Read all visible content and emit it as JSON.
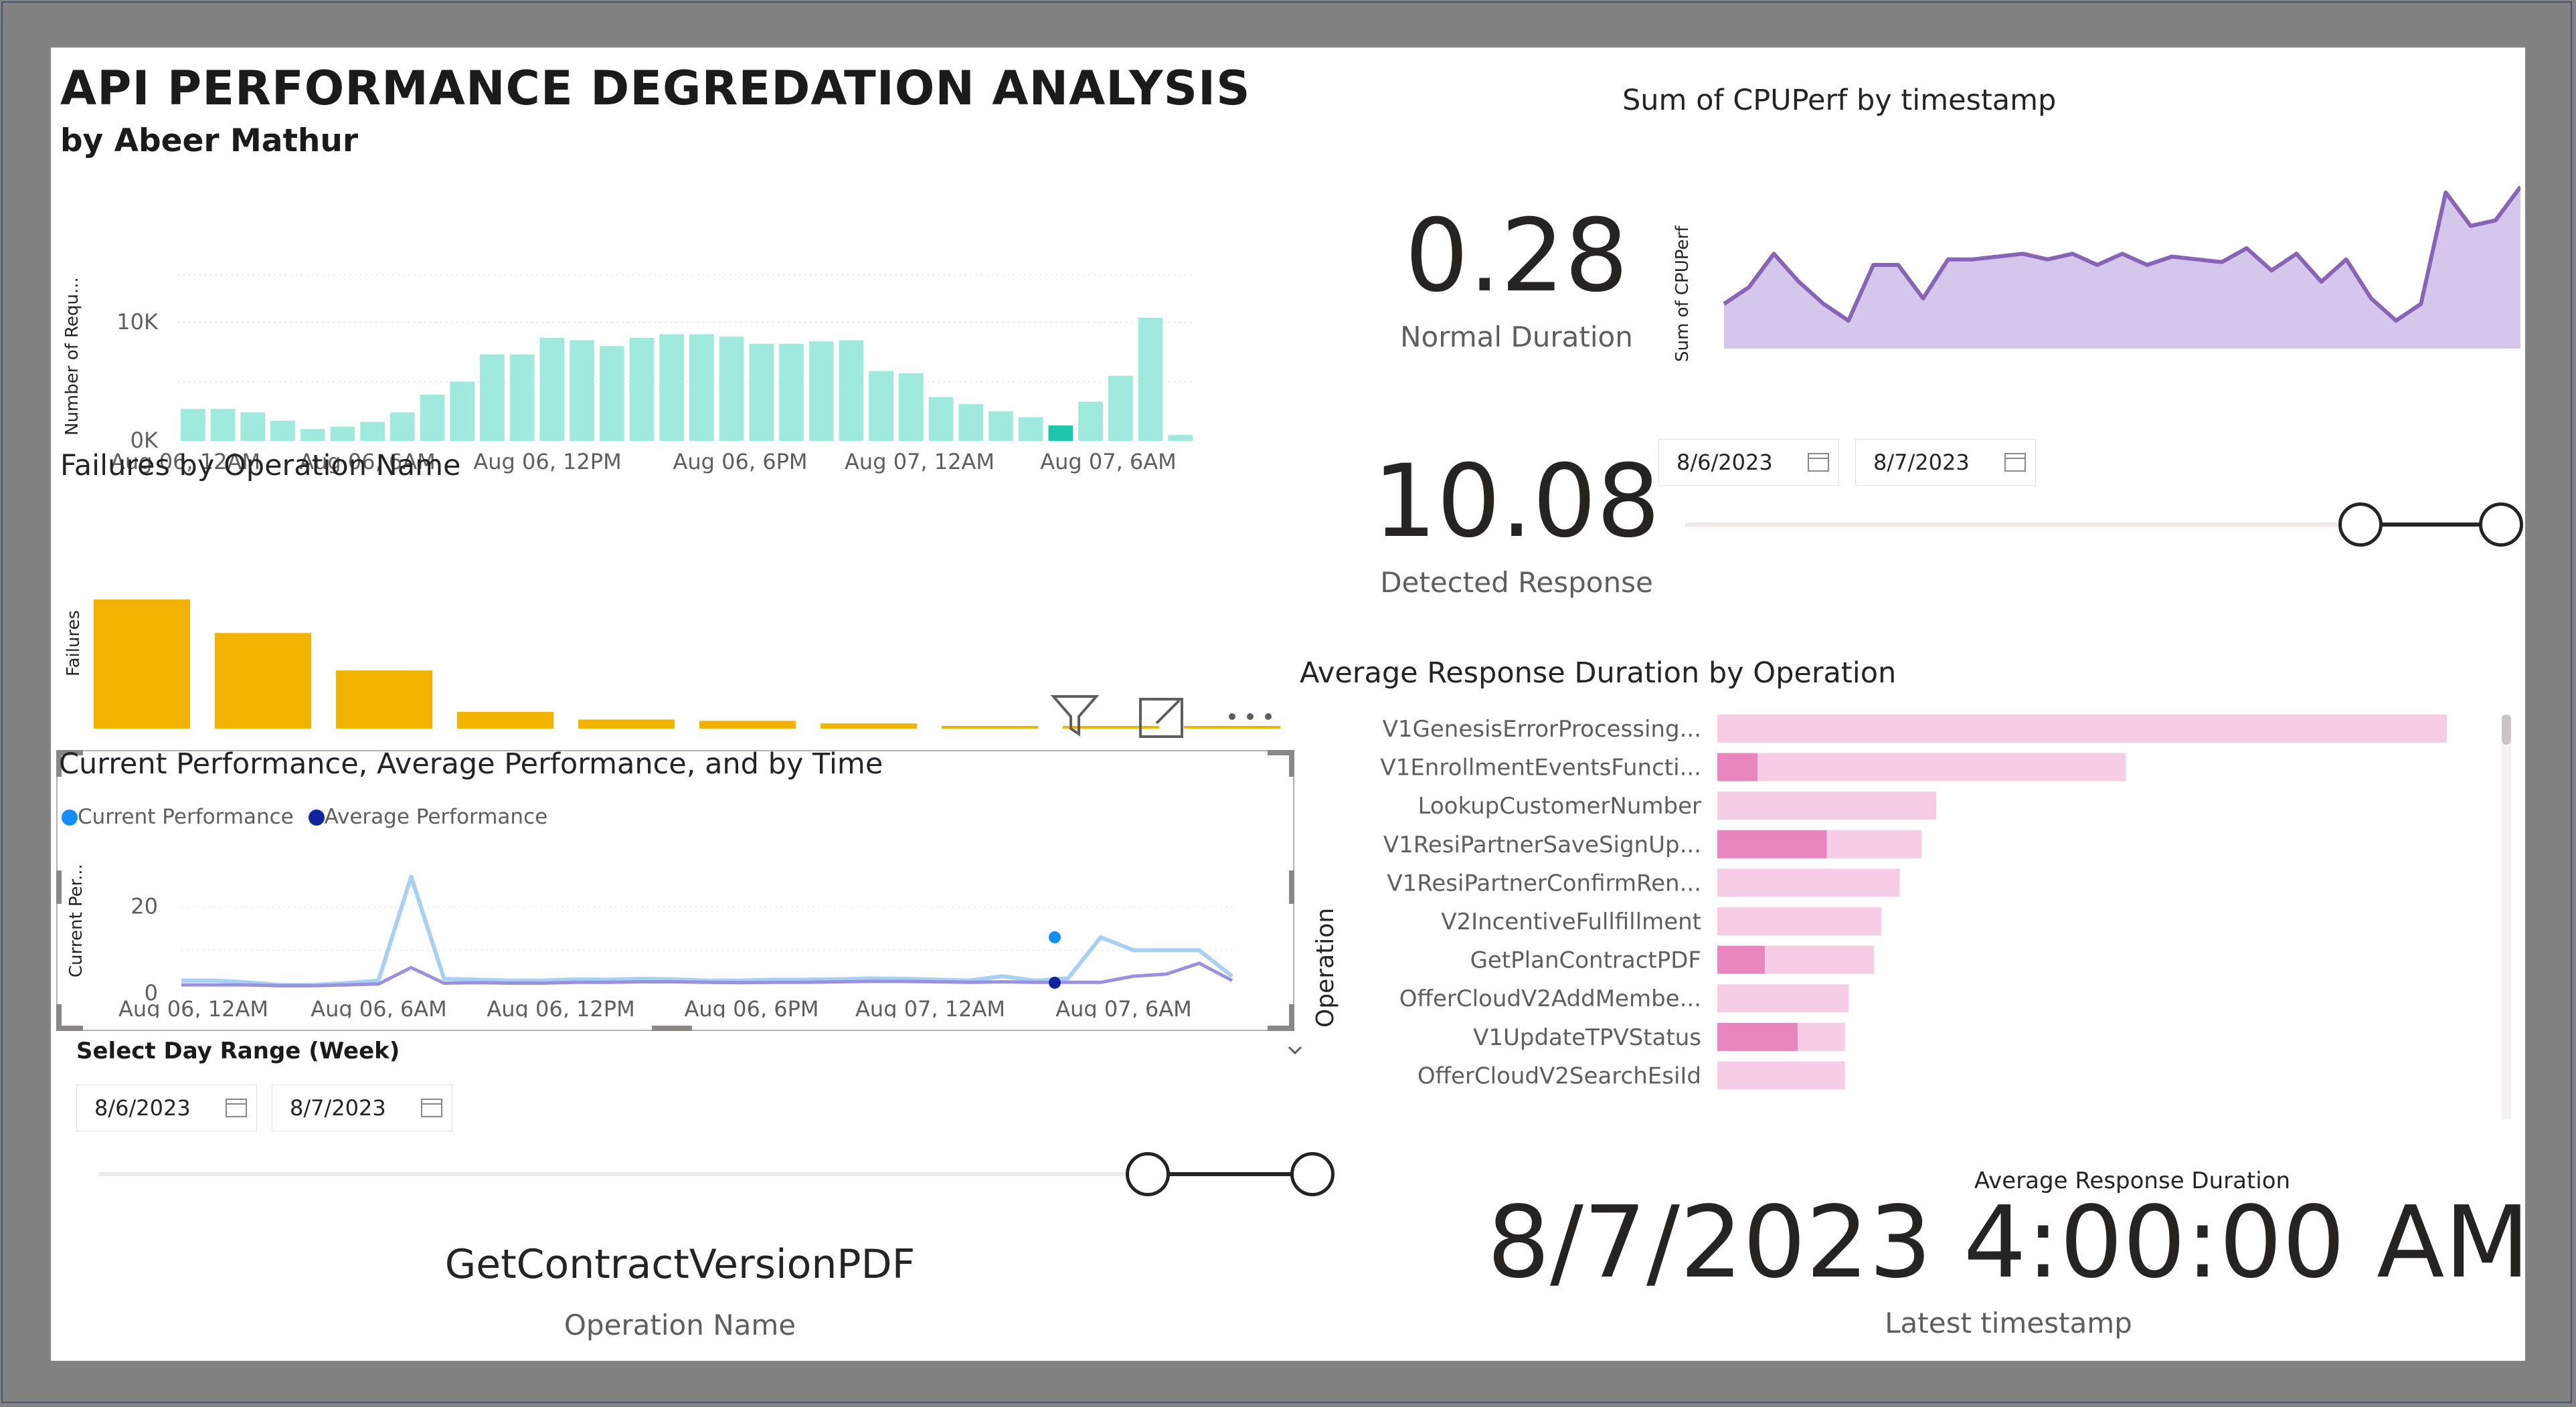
{
  "header": {
    "title": "API PERFORMANCE DEGREDATION ANALYSIS",
    "subtitle": "by Abeer Mathur"
  },
  "requests_chart": {
    "chart_data": {
      "type": "bar",
      "ylabel": "Number of Requ...",
      "yticks": [
        "10K",
        "0K"
      ],
      "xticks": [
        "Aug 06, 12AM",
        "Aug 06, 6AM",
        "Aug 06, 12PM",
        "Aug 06, 6PM",
        "Aug 07, 12AM",
        "Aug 07, 6AM"
      ],
      "ylim": [
        0,
        14000
      ],
      "values": [
        2700,
        2700,
        2400,
        1700,
        1000,
        1200,
        1600,
        2400,
        3900,
        5000,
        7300,
        7300,
        8700,
        8500,
        8000,
        8700,
        9000,
        9000,
        8800,
        8200,
        8200,
        8400,
        8500,
        5900,
        5700,
        3700,
        3100,
        2500,
        2000,
        1300,
        3300,
        5500,
        10400,
        500
      ],
      "highlight_index": 29,
      "colors": {
        "bar": "#9fe9dd",
        "highlight": "#1ec7a9"
      }
    }
  },
  "failures_chart": {
    "title": "Failures by Operation Name",
    "chart_data": {
      "type": "bar",
      "ylabel": "Failures",
      "values": [
        100,
        74,
        45,
        13,
        7,
        6,
        4,
        2,
        1,
        1
      ],
      "colors": {
        "bar": "#f2b200"
      }
    }
  },
  "visual_header": {
    "filter_icon": "filter-icon",
    "focus_icon": "focus-mode-icon",
    "more_icon": "more-options-icon"
  },
  "perf_chart": {
    "title": "Current Performance, Average Performance, and by Time",
    "legend": [
      "Current Performance",
      "Average Performance"
    ],
    "chart_data": {
      "type": "line",
      "ylabel": "Current Per...",
      "yticks": [
        "20",
        "0"
      ],
      "xticks": [
        "Aug 06, 12AM",
        "Aug 06, 6AM",
        "Aug 06, 12PM",
        "Aug 06, 6PM",
        "Aug 07, 12AM",
        "Aug 07, 6AM"
      ],
      "ylim": [
        0,
        30
      ],
      "series": [
        {
          "name": "Current Performance",
          "color": "#a8cff5",
          "values": [
            3,
            3,
            2.6,
            2,
            2,
            2.4,
            3,
            27,
            3.4,
            3.2,
            3,
            3,
            3.3,
            3.2,
            3.4,
            3.3,
            3,
            3,
            3.2,
            3.2,
            3.3,
            3.5,
            3.4,
            3.2,
            3,
            4,
            3,
            3.5,
            13,
            10,
            10,
            10,
            4
          ]
        },
        {
          "name": "Average Performance",
          "color": "#9b90e0",
          "values": [
            2,
            2,
            2,
            1.8,
            1.8,
            2,
            2.2,
            6,
            2.4,
            2.5,
            2.4,
            2.4,
            2.6,
            2.6,
            2.7,
            2.7,
            2.6,
            2.5,
            2.6,
            2.6,
            2.7,
            2.8,
            2.8,
            2.7,
            2.6,
            2.7,
            2.6,
            2.6,
            2.6,
            4,
            4.5,
            7,
            3
          ]
        }
      ],
      "markers": {
        "current": 13,
        "average": 2.5
      },
      "colors": {
        "current_dot": "#118dff",
        "average_dot": "#12239e"
      }
    }
  },
  "slicer_left": {
    "title": "Select Day Range (Week)",
    "start": "8/6/2023",
    "end": "8/7/2023",
    "range": [
      1,
      1
    ]
  },
  "operation_card": {
    "value": "GetContractVersionPDF",
    "label": "Operation Name"
  },
  "kpis": [
    {
      "value": "0.28",
      "label": "Normal Duration"
    },
    {
      "value": "10.08",
      "label": "Detected Response"
    }
  ],
  "cpu_chart": {
    "title": "Sum of CPUPerf by timestamp",
    "chart_data": {
      "type": "area",
      "ylabel": "Sum of CPUPerf",
      "values": [
        8,
        11,
        17,
        12,
        8,
        5,
        15,
        15,
        9,
        16,
        16,
        16.5,
        17,
        16,
        17,
        15,
        17,
        15,
        16.5,
        16,
        15.5,
        18,
        14,
        17,
        12,
        16,
        9,
        5,
        8,
        28,
        22,
        23,
        29
      ],
      "ylim": [
        0,
        30
      ],
      "colors": {
        "line": "#8764b8",
        "fill": "#d4c7eb"
      }
    }
  },
  "slicer_right": {
    "start": "8/6/2023",
    "end": "8/7/2023",
    "range": [
      1,
      1
    ]
  },
  "avg_duration_chart": {
    "title": "Average Response Duration by Operation",
    "chart_data": {
      "type": "bar",
      "orientation": "horizontal",
      "xlabel": "Average Response Duration",
      "ylabel": "Operation",
      "categories": [
        "V1GenesisErrorProcessing...",
        "V1EnrollmentEventsFuncti...",
        "LookupCustomerNumber",
        "V1ResiPartnerSaveSignUp...",
        "V1ResiPartnerConfirmRen...",
        "V2IncentiveFullfillment",
        "GetPlanContractPDF",
        "OfferCloudV2AddMembe...",
        "V1UpdateTPVStatus",
        "OfferCloudV2SearchEsiId"
      ],
      "values": [
        100,
        56,
        30,
        28,
        25,
        22.5,
        21.5,
        18,
        17.5,
        17.5
      ],
      "highlight_values": [
        0,
        5.5,
        0,
        15,
        0,
        0,
        6.5,
        0,
        11,
        0
      ],
      "colors": {
        "bar": "#f6cde5",
        "highlight": "#e986c0"
      }
    }
  },
  "latest_card": {
    "value": "8/7/2023 4:00:00 AM",
    "label": "Latest timestamp"
  }
}
